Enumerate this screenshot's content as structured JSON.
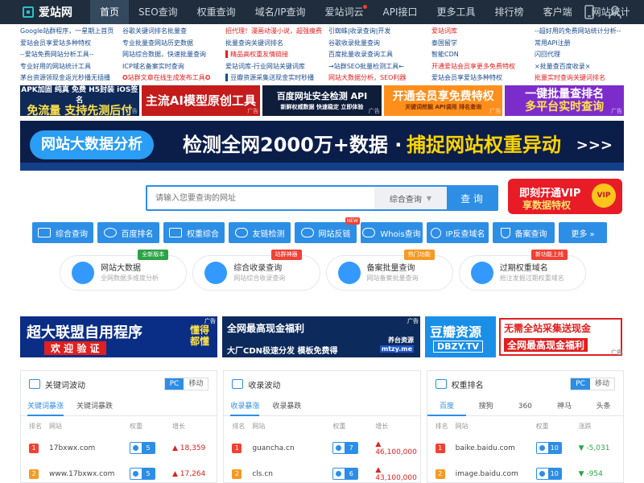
{
  "app": {
    "logo_text": "爱站网"
  },
  "nav": [
    {
      "label": "首页",
      "active": true
    },
    {
      "label": "SEO查询"
    },
    {
      "label": "权重查询"
    },
    {
      "label": "域名/IP查询"
    },
    {
      "label": "爱站词云",
      "dot": true
    },
    {
      "label": "API接口"
    },
    {
      "label": "更多工具"
    },
    {
      "label": "排行榜"
    },
    {
      "label": "客户端"
    },
    {
      "label": "网站统计"
    }
  ],
  "top_icons": {
    "mobile": "mobile-icon",
    "user": "user-icon"
  },
  "links": [
    [
      {
        "t": "Google站群程序，一星期上首页"
      },
      {
        "t": "谷歌关键词排名批量查"
      },
      {
        "t": "招代理！漫画动漫小说，超强痩费",
        "red": true
      },
      {
        "t": "引蜘蛛|收录查询|开发"
      },
      {
        "t": "爱站词库",
        "red": true
      },
      {
        "t": "--超好用的免费网站统计分析--"
      }
    ],
    [
      {
        "t": "爱站会员享爱站多种特权"
      },
      {
        "t": "专业批量查网站历史数据"
      },
      {
        "t": "批量查询关键词排名"
      },
      {
        "t": "谷歌收录批量查询"
      },
      {
        "t": "泰国留学"
      },
      {
        "t": "常用API注册"
      }
    ],
    [
      {
        "t": "--爱站免费网站分析工具--"
      },
      {
        "t": "网站综合数据，快速批量查询"
      },
      {
        "t": "▌精品高权重友情链接",
        "red": true
      },
      {
        "t": "百度批量收录查询工具"
      },
      {
        "t": "智能CDN"
      },
      {
        "t": "闪回代理"
      }
    ],
    [
      {
        "t": "专业好用的网站统计工具"
      },
      {
        "t": "ICP域名备案实时查询"
      },
      {
        "t": "爱站词库-行业网站关键词库"
      },
      {
        "t": "→站群SEO批量检测工具←"
      },
      {
        "t": "开通爱站会员享更多免费特权",
        "red": true
      },
      {
        "t": "×批量查百度收录×"
      }
    ],
    [
      {
        "t": "茅台资源领现金返光秒播无插播"
      },
      {
        "t": "✪站群文章在线生成发布工具✪",
        "red": true
      },
      {
        "t": "▌豆瓣资源采集送现金实时秒播"
      },
      {
        "t": "网站大数据分析，SEO利器",
        "red": true
      },
      {
        "t": "爱站会员享爱站多种特权"
      },
      {
        "t": "批量实时查询关键词排名",
        "red": true
      }
    ]
  ],
  "ads_top": [
    {
      "l1": "APK加固 纯真 免费 H5封装 iOS签名",
      "l2": "免流量 支持先测后付",
      "tag": "广告"
    },
    {
      "l1": "主流AI模型原创工具",
      "tag": "广告"
    },
    {
      "l1": "百度网址安全检测 API",
      "l2": "新鲜权威数据 快速稳定 立即体验",
      "tag": "广告"
    },
    {
      "l1": "开通会员享免费特权",
      "l2": "关键词挖掘  API调用  排名查询",
      "tag": "广告"
    },
    {
      "l1": "一键批量查排名",
      "l2": "多平台实时查询",
      "tag": "广告"
    }
  ],
  "hero": {
    "pill": "网站大数据分析",
    "t1": "检测全网2000万+数据 · ",
    "t2": "捕捉网站权重异动",
    "arrows": ">>>"
  },
  "search": {
    "placeholder": "请输入您要查询的网址",
    "select": "综合查询",
    "button": "查 询"
  },
  "vip": {
    "l1": "即刻开通VIP",
    "l2": "享数据特权",
    "badge": "VIP"
  },
  "tools": [
    {
      "label": "综合查询",
      "icon": "monitor-icon"
    },
    {
      "label": "百度排名",
      "icon": "paw-icon"
    },
    {
      "label": "权重综合",
      "icon": "rank-icon"
    },
    {
      "label": "友链检测",
      "icon": "link-icon"
    },
    {
      "label": "网站反链",
      "icon": "chain-icon",
      "badge": "NEW"
    },
    {
      "label": "Whois查询",
      "icon": "whois-icon"
    },
    {
      "label": "IP反查域名",
      "icon": "ip-icon"
    },
    {
      "label": "备案查询",
      "icon": "shield-icon"
    },
    {
      "label": "更多 »",
      "icon": ""
    }
  ],
  "features": [
    {
      "title": "网站大数据",
      "sub": "全网数据多维度分析",
      "tag": "全新版本",
      "tag_color": "#2ba245"
    },
    {
      "title": "综合收录查询",
      "sub": "网站综合收录查询",
      "tag": "站群神器",
      "tag_color": "#f04134"
    },
    {
      "title": "备案批量查询",
      "sub": "网站备案批量查询",
      "tag": "热门功能",
      "tag_color": "#f59a23"
    },
    {
      "title": "过期权重域名",
      "sub": "抢注发掘过期权重域名",
      "tag": "新功能上线",
      "tag_color": "#f04134"
    }
  ],
  "ads_mid": [
    {
      "l1": "超大联盟自用程序",
      "l2": "欢 迎 验 证",
      "r": "懂得 都懂",
      "tag": "广告"
    },
    {
      "l1": "全网最高现金福利",
      "l2": "大厂CDN极速分发 模板免费得",
      "brand": "养台资源",
      "site": "mtzy.me",
      "tag": "广告"
    },
    {
      "l1": "豆瓣资源",
      "l2": "DBZY.TV",
      "r1": "无需全站采集送现金",
      "r2": "全网最高现金福利",
      "tag": "广告"
    }
  ],
  "panels": [
    {
      "title": "关键词波动",
      "switch": [
        "PC",
        "移动"
      ],
      "tabs": [
        "关键词暴涨",
        "关键词暴跌"
      ],
      "cols": [
        "排名",
        "网站",
        "权重",
        "增长"
      ],
      "rows": [
        {
          "rank": "1",
          "site": "17bxwx.com",
          "w": "5",
          "d": "▲ 18,359",
          "up": true
        },
        {
          "rank": "2",
          "site": "www.17bxwx.com",
          "w": "5",
          "d": "▲ 17,264",
          "up": true
        }
      ]
    },
    {
      "title": "收录波动",
      "switch": [],
      "tabs": [
        "收录暴涨",
        "收录暴跌"
      ],
      "cols": [
        "排名",
        "网站",
        "权重",
        "增长"
      ],
      "rows": [
        {
          "rank": "1",
          "site": "guancha.cn",
          "w": "7",
          "d": "▲ 46,100,000",
          "up": true
        },
        {
          "rank": "2",
          "site": "cls.cn",
          "w": "6",
          "d": "▲ 43,100,000",
          "up": true
        }
      ]
    },
    {
      "title": "权重排名",
      "switch": [
        "PC",
        "移动"
      ],
      "tabs": [
        "百度",
        "搜狗",
        "360",
        "神马",
        "头条"
      ],
      "cols": [
        "排名",
        "网站",
        "权重",
        "涨跌"
      ],
      "rows": [
        {
          "rank": "1",
          "site": "baike.baidu.com",
          "w": "10",
          "d": "▼ -5,031",
          "up": false
        },
        {
          "rank": "2",
          "site": "image.baidu.com",
          "w": "10",
          "d": "▼ -954",
          "up": false
        }
      ]
    }
  ],
  "colors": {
    "nav_bg": "#1f2d3d",
    "accent": "#2d8ee6",
    "red": "#e02020",
    "green": "#28a745"
  }
}
